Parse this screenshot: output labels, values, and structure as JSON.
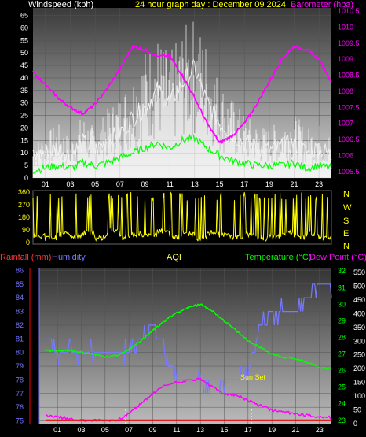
{
  "header": {
    "left": "Windspeed (kph)",
    "center": "24 hour graph day : December 09 2024",
    "right": "Barometer (hpa)"
  },
  "lower_header": {
    "rainfall": "Rainfall (mm)",
    "humidity": "Humidity",
    "aqi": "AQI",
    "temperature": "Temperature (°C)",
    "dewpoint": "Dew Point (°C)"
  },
  "direction_labels": [
    "N",
    "W",
    "S",
    "E",
    "N"
  ],
  "annotation": "Sun Set",
  "colors": {
    "wind": "#ffffff",
    "gust": "#e0e0e0",
    "avg_wind": "#00ff00",
    "barometer": "#ff00ff",
    "direction": "#ffff00",
    "humidity": "#7777ff",
    "temperature": "#00ff00",
    "rainfall": "#ff0000",
    "dewpoint": "#ff00ff",
    "solar": "#ffff00"
  },
  "chart_data": [
    {
      "type": "line",
      "name": "wind-barometer",
      "x": [
        0,
        1,
        2,
        3,
        4,
        5,
        6,
        7,
        8,
        9,
        10,
        11,
        12,
        13,
        14,
        15,
        16,
        17,
        18,
        19,
        20,
        21,
        22,
        23,
        24
      ],
      "xticks": [
        "01",
        "03",
        "05",
        "07",
        "09",
        "11",
        "13",
        "15",
        "17",
        "19",
        "21",
        "23"
      ],
      "yticks_left": [
        0,
        5,
        10,
        15,
        20,
        25,
        30,
        35,
        40,
        45,
        50,
        55,
        60,
        65
      ],
      "yticks_right": [
        "1005.5",
        "1006",
        "1006.5",
        "1007",
        "1007.5",
        "1008",
        "1008.5",
        "1009",
        "1009.5",
        "1010",
        "1010.5"
      ],
      "ylim_left": [
        0,
        68
      ],
      "ylim_right": [
        1005.3,
        1010.6
      ],
      "series": [
        {
          "axis": "right",
          "values": [
            1008.6,
            1008.2,
            1007.8,
            1007.5,
            1007.3,
            1007.6,
            1008.1,
            1008.7,
            1009.4,
            1009.3,
            1009.1,
            1009.1,
            1008.5,
            1007.8,
            1007.0,
            1006.4,
            1006.6,
            1007.0,
            1007.6,
            1008.3,
            1009.0,
            1009.4,
            1009.3,
            1009.0,
            1008.3
          ]
        },
        {
          "axis": "left",
          "values": [
            8,
            10,
            12,
            9,
            14,
            11,
            15,
            18,
            24,
            28,
            35,
            30,
            38,
            44,
            30,
            22,
            18,
            14,
            12,
            11,
            12,
            14,
            10,
            12,
            9
          ]
        },
        {
          "axis": "left",
          "values": [
            14,
            18,
            22,
            16,
            26,
            20,
            28,
            34,
            42,
            52,
            58,
            50,
            60,
            65,
            55,
            40,
            32,
            26,
            22,
            20,
            24,
            26,
            20,
            22,
            18
          ]
        },
        {
          "axis": "left",
          "values": [
            3,
            4,
            5,
            4,
            6,
            5,
            6,
            8,
            10,
            12,
            14,
            12,
            15,
            16,
            12,
            9,
            7,
            6,
            5,
            5,
            5,
            6,
            4,
            5,
            4
          ]
        }
      ]
    },
    {
      "type": "line",
      "name": "wind-direction",
      "x": [
        0,
        1,
        2,
        3,
        4,
        5,
        6,
        7,
        8,
        9,
        10,
        11,
        12,
        13,
        14,
        15,
        16,
        17,
        18,
        19,
        20,
        21,
        22,
        23,
        24
      ],
      "yticks": [
        0,
        90,
        180,
        270,
        360
      ],
      "ylim": [
        0,
        360
      ],
      "series": [
        {
          "values": [
            50,
            30,
            60,
            40,
            70,
            30,
            90,
            40,
            60,
            50,
            80,
            40,
            60,
            30,
            70,
            50,
            40,
            60,
            30,
            50,
            70,
            40,
            60,
            30,
            40
          ]
        }
      ]
    },
    {
      "type": "line",
      "name": "temp-humidity",
      "x": [
        0,
        1,
        2,
        3,
        4,
        5,
        6,
        7,
        8,
        9,
        10,
        11,
        12,
        13,
        14,
        15,
        16,
        17,
        18,
        19,
        20,
        21,
        22,
        23,
        24
      ],
      "xticks": [
        "01",
        "03",
        "05",
        "07",
        "09",
        "11",
        "13",
        "15",
        "17",
        "19",
        "21",
        "23"
      ],
      "yticks_left": [
        75,
        76,
        77,
        78,
        79,
        80,
        81,
        82,
        83,
        84,
        85,
        86
      ],
      "yticks_right": [
        23,
        24,
        25,
        26,
        27,
        28,
        29,
        30,
        31,
        32
      ],
      "yticks_aqi": [
        0,
        50,
        100,
        150,
        200,
        250,
        300,
        350,
        400,
        450,
        500,
        550
      ],
      "ylim_left": [
        74.8,
        86.2
      ],
      "ylim_right": [
        22.8,
        32.2
      ],
      "series": [
        {
          "axis": "right",
          "values": [
            27.2,
            27.2,
            27.2,
            27.1,
            27.0,
            26.8,
            26.9,
            27.3,
            27.8,
            28.4,
            29.0,
            29.5,
            29.8,
            30.0,
            29.6,
            29.0,
            28.4,
            27.8,
            27.4,
            27.0,
            26.8,
            26.7,
            26.5,
            26.2,
            26.1
          ]
        },
        {
          "axis": "left",
          "values": [
            81,
            80,
            80,
            80,
            80,
            80,
            80,
            80,
            81,
            82,
            80,
            78,
            78,
            78,
            77,
            78,
            78,
            79,
            82,
            83,
            83,
            83,
            84,
            85,
            84
          ]
        },
        {
          "axis": "right",
          "values": [
            23.3,
            23.2,
            23.1,
            23.0,
            23.0,
            23.0,
            23.0,
            23.4,
            24.0,
            24.6,
            25.1,
            25.3,
            25.4,
            25.5,
            25.0,
            24.6,
            24.5,
            24.2,
            23.9,
            23.6,
            23.5,
            23.4,
            23.3,
            23.2,
            23.2
          ]
        },
        {
          "axis": "right",
          "values": [
            23.0,
            23.0,
            23.0,
            23.0,
            23.0,
            23.0,
            23.0,
            23.0,
            23.0,
            23.0,
            23.0,
            23.0,
            23.0,
            23.0,
            23.0,
            23.0,
            23.0,
            23.0,
            23.0,
            23.0,
            23.0,
            23.0,
            23.0,
            23.0,
            23.0
          ]
        }
      ]
    }
  ]
}
